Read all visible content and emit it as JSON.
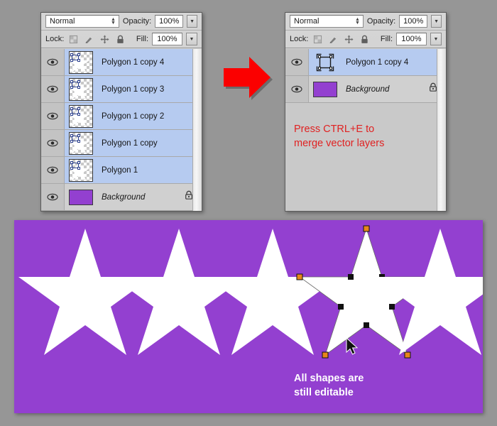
{
  "app": {
    "background_color": "#969696",
    "panel_color": "#c8c8c8",
    "canvas_color": "#9340d0",
    "selection_color": "#b6cbf0",
    "accent_red": "#e02222",
    "star_color": "#ffffff"
  },
  "panel_before": {
    "blend_mode": "Normal",
    "opacity_label": "Opacity:",
    "opacity_value": "100%",
    "lock_label": "Lock:",
    "fill_label": "Fill:",
    "fill_value": "100%",
    "lock_icons": [
      "lock-transparent-pixels-icon",
      "lock-image-pixels-icon",
      "lock-position-icon",
      "lock-all-icon"
    ],
    "layers": [
      {
        "name": "Polygon 1 copy 4",
        "type": "vector",
        "visible": true,
        "selected": true,
        "locked": false,
        "italic": false
      },
      {
        "name": "Polygon 1 copy 3",
        "type": "vector",
        "visible": true,
        "selected": true,
        "locked": false,
        "italic": false
      },
      {
        "name": "Polygon 1 copy 2",
        "type": "vector",
        "visible": true,
        "selected": true,
        "locked": false,
        "italic": false
      },
      {
        "name": "Polygon 1 copy",
        "type": "vector",
        "visible": true,
        "selected": true,
        "locked": false,
        "italic": false
      },
      {
        "name": "Polygon 1",
        "type": "vector",
        "visible": true,
        "selected": true,
        "locked": false,
        "italic": false
      },
      {
        "name": "Background",
        "type": "raster",
        "visible": true,
        "selected": false,
        "locked": true,
        "italic": true
      }
    ]
  },
  "panel_after": {
    "blend_mode": "Normal",
    "opacity_label": "Opacity:",
    "opacity_value": "100%",
    "lock_label": "Lock:",
    "fill_label": "Fill:",
    "fill_value": "100%",
    "layers": [
      {
        "name": "Polygon 1 copy 4",
        "type": "merged-vector",
        "visible": true,
        "selected": true,
        "locked": false,
        "italic": false
      },
      {
        "name": "Background",
        "type": "raster",
        "visible": true,
        "selected": false,
        "locked": true,
        "italic": true
      }
    ]
  },
  "annotations": {
    "arrow": "red-right-arrow-icon",
    "merge_note_line1": "Press CTRL+E to",
    "merge_note_line2": "merge vector layers",
    "editable_note_line1": "All shapes are",
    "editable_note_line2": "still editable"
  },
  "canvas": {
    "star_count": 5,
    "selected_star_index": 4,
    "anchor_points_visible": true,
    "cursor": "arrow-cursor-icon"
  }
}
